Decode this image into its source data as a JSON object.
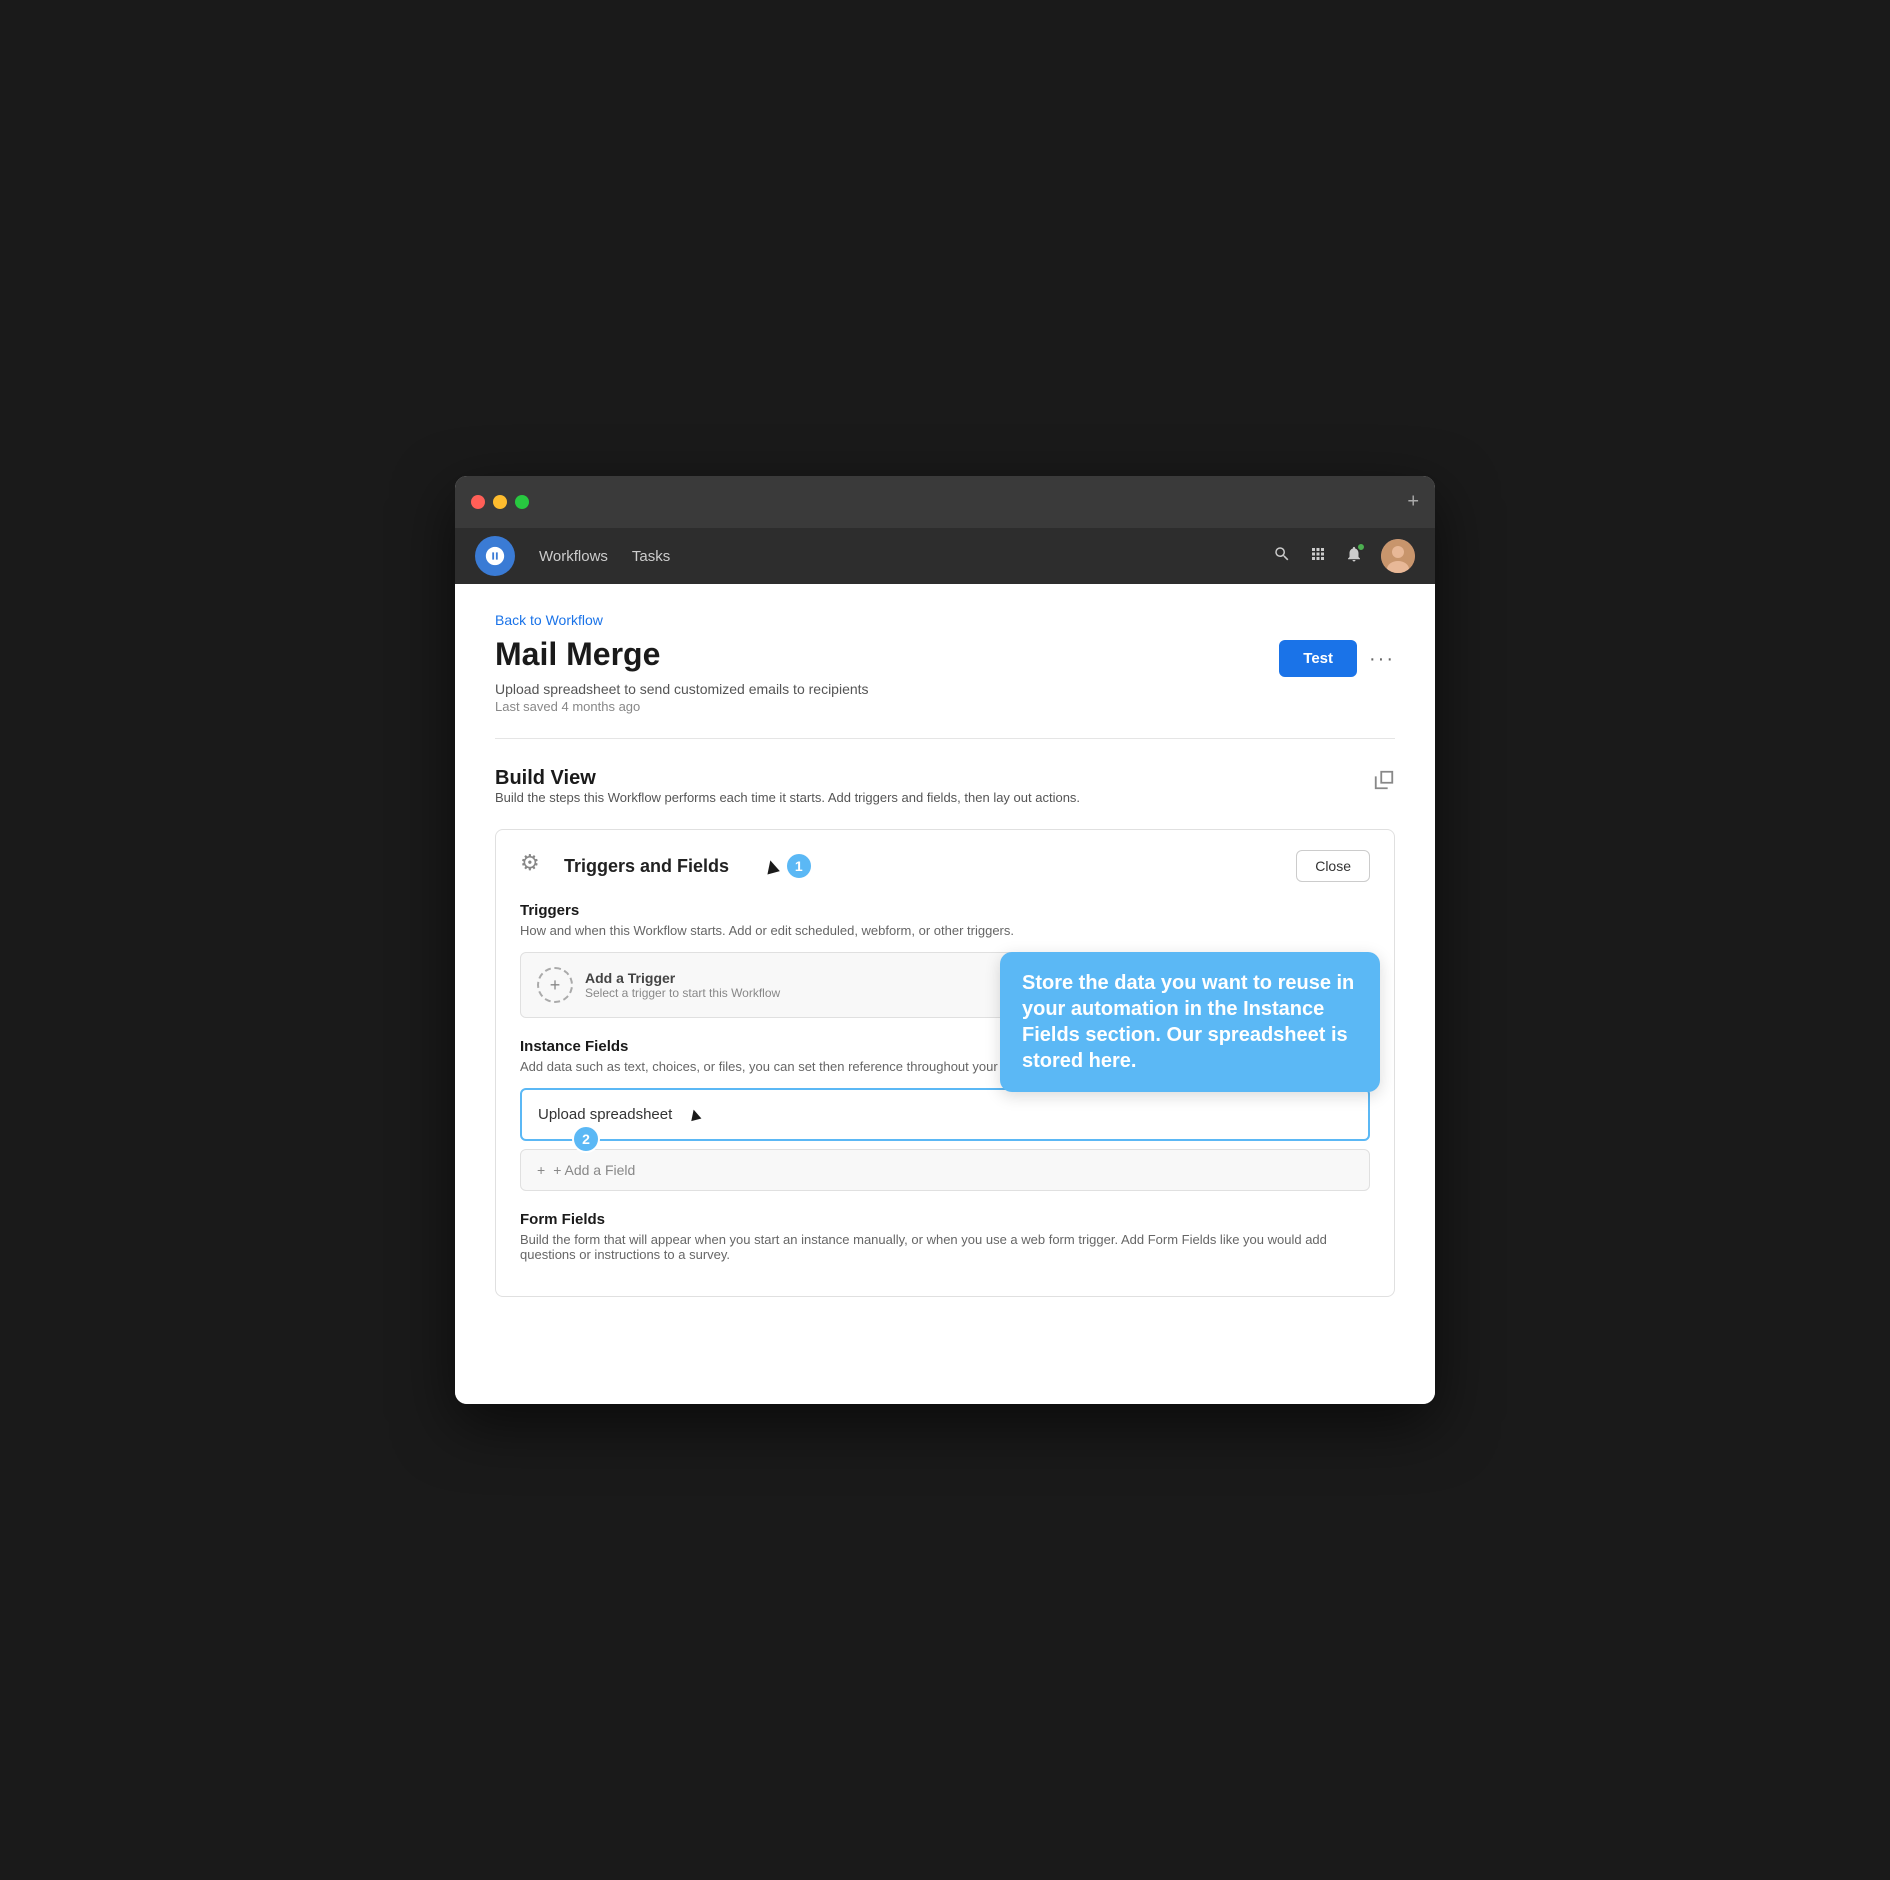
{
  "window": {
    "plus_label": "+"
  },
  "nav": {
    "workflows_label": "Workflows",
    "tasks_label": "Tasks"
  },
  "breadcrumb": {
    "label": "Back to Workflow"
  },
  "page": {
    "title": "Mail Merge",
    "subtitle": "Upload spreadsheet to send customized emails to recipients",
    "meta": "Last saved 4 months ago",
    "test_btn": "Test",
    "more_btn": "···"
  },
  "build_view": {
    "title": "Build View",
    "subtitle": "Build the steps this Workflow performs each time it starts. Add triggers and fields, then lay out actions."
  },
  "panel": {
    "title": "Triggers and Fields",
    "close_btn": "Close",
    "step1_badge": "1",
    "step2_badge": "2"
  },
  "triggers": {
    "title": "Triggers",
    "desc": "How and when this Workflow starts. Add or edit scheduled, webform, or other triggers.",
    "add_label": "Add a Trigger",
    "add_sub": "Select a trigger to start this Workflow"
  },
  "tooltip": {
    "text": "Store the data you want to reuse in your automation in the Instance Fields section. Our spreadsheet is stored here."
  },
  "instance_fields": {
    "title": "Instance Fields",
    "desc": "Add data such as text, choices, or files, you can set then reference throughout your Workflow.",
    "upload_label": "Upload spreadsheet",
    "add_field_label": "+ Add a Field"
  },
  "form_fields": {
    "title": "Form Fields",
    "desc": "Build the form that will appear when you start an instance manually, or when you use a web form trigger. Add Form Fields like you would add questions or instructions to a survey."
  },
  "icons": {
    "search": "🔍",
    "grid": "⠿",
    "bell": "🔔",
    "gear": "⚙",
    "cursor": "▲",
    "chevron_right": "›",
    "plus": "+",
    "expand": "⤢"
  }
}
